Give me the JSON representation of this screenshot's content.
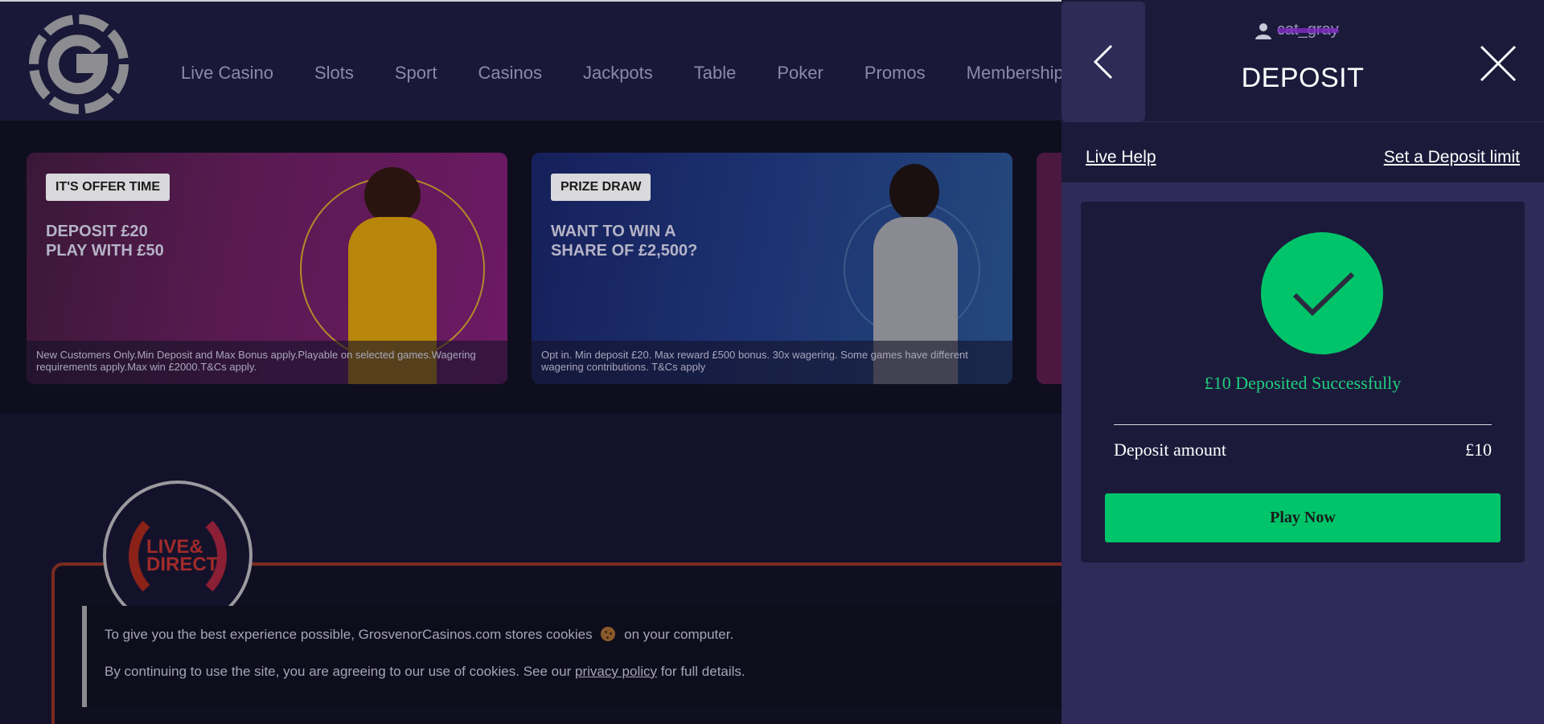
{
  "nav": {
    "items": [
      "Live Casino",
      "Slots",
      "Sport",
      "Casinos",
      "Jackpots",
      "Table",
      "Poker",
      "Promos",
      "Membership"
    ]
  },
  "promos": [
    {
      "badge": "IT'S OFFER TIME",
      "headline_1": "DEPOSIT £20",
      "headline_2": "PLAY WITH £50",
      "terms": "New Customers Only.Min Deposit and Max Bonus apply.Playable on selected games.Wagering requirements apply.Max win £2000.T&Cs apply."
    },
    {
      "badge": "PRIZE DRAW",
      "headline_1": "WANT TO WIN A",
      "headline_2": "SHARE OF £2,500?",
      "terms": "Opt in. Min deposit £20. Max reward £500 bonus. 30x wagering. Some games have different wagering contributions. T&Cs apply"
    }
  ],
  "live_logo": {
    "line_1": "LIVE&",
    "line_2": "DIRECT"
  },
  "cookie": {
    "line_1_before": "To give you the best experience possible, GrosvenorCasinos.com stores cookies",
    "line_1_after": "on your computer.",
    "line_2_before": "By continuing to use the site, you are agreeing to our use of cookies. See our",
    "link": "privacy policy",
    "line_2_after": "for full details."
  },
  "panel": {
    "username": "cat_gray",
    "title": "DEPOSIT",
    "live_help": "Live Help",
    "deposit_limit": "Set a Deposit limit",
    "success_message": "£10 Deposited Successfully",
    "amount_label": "Deposit amount",
    "amount_value": "£10",
    "play_button": "Play Now"
  },
  "colors": {
    "accent_green": "#00c46a",
    "panel_bg": "#302a58",
    "header_bg": "#1a1838"
  }
}
